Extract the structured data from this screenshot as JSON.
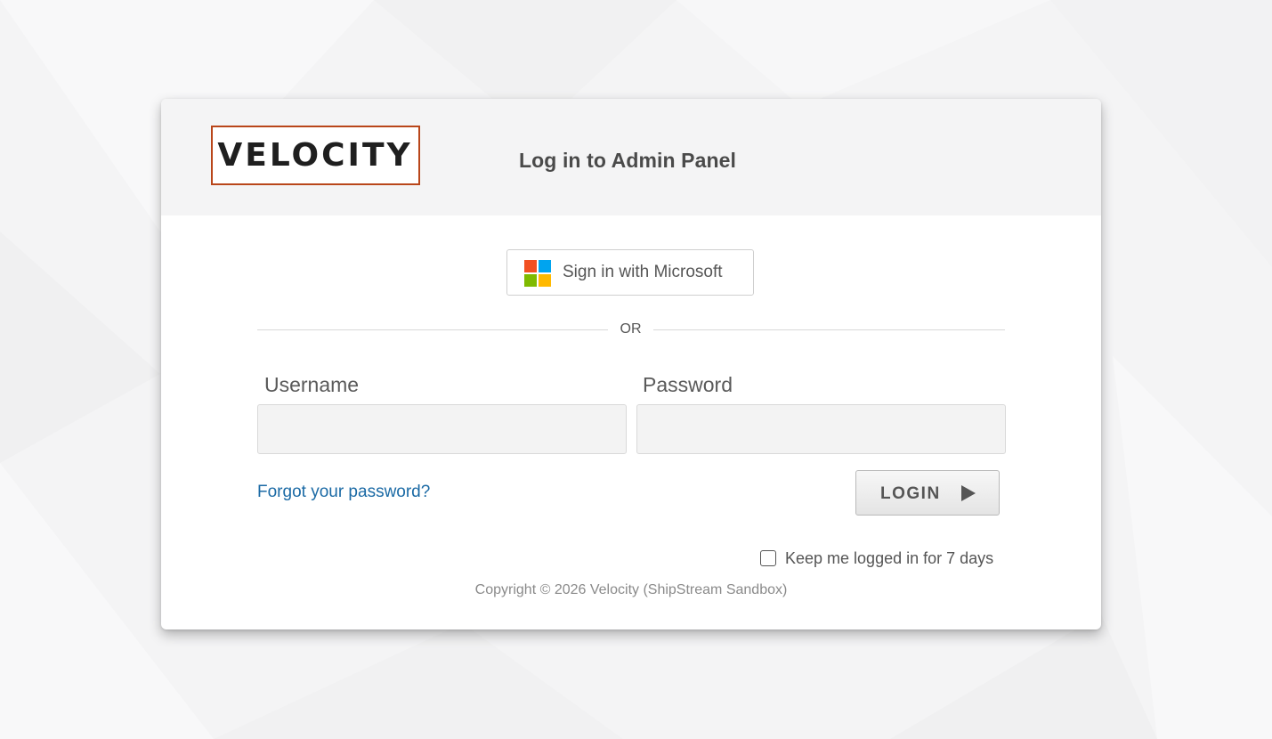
{
  "header": {
    "logo_text": "VELOCITY",
    "title": "Log in to Admin Panel"
  },
  "sso": {
    "label": "Sign in with Microsoft",
    "icon": "microsoft-logo-icon",
    "colors": [
      "#f25022",
      "#00a4ef",
      "#7fba00",
      "#ffb900"
    ]
  },
  "divider": {
    "text": "OR"
  },
  "form": {
    "username_label": "Username",
    "username_value": "",
    "password_label": "Password",
    "password_value": "",
    "forgot_link": "Forgot your password?",
    "login_button": "LOGIN",
    "login_icon": "play-icon",
    "keep_logged_in_label": "Keep me logged in for 7 days",
    "keep_logged_in_checked": false
  },
  "footer": {
    "copyright": "Copyright © 2026 Velocity (ShipStream Sandbox)"
  },
  "colors": {
    "logo_border": "#b9461a",
    "link": "#1b6aa5",
    "header_bg": "#f4f4f5"
  }
}
